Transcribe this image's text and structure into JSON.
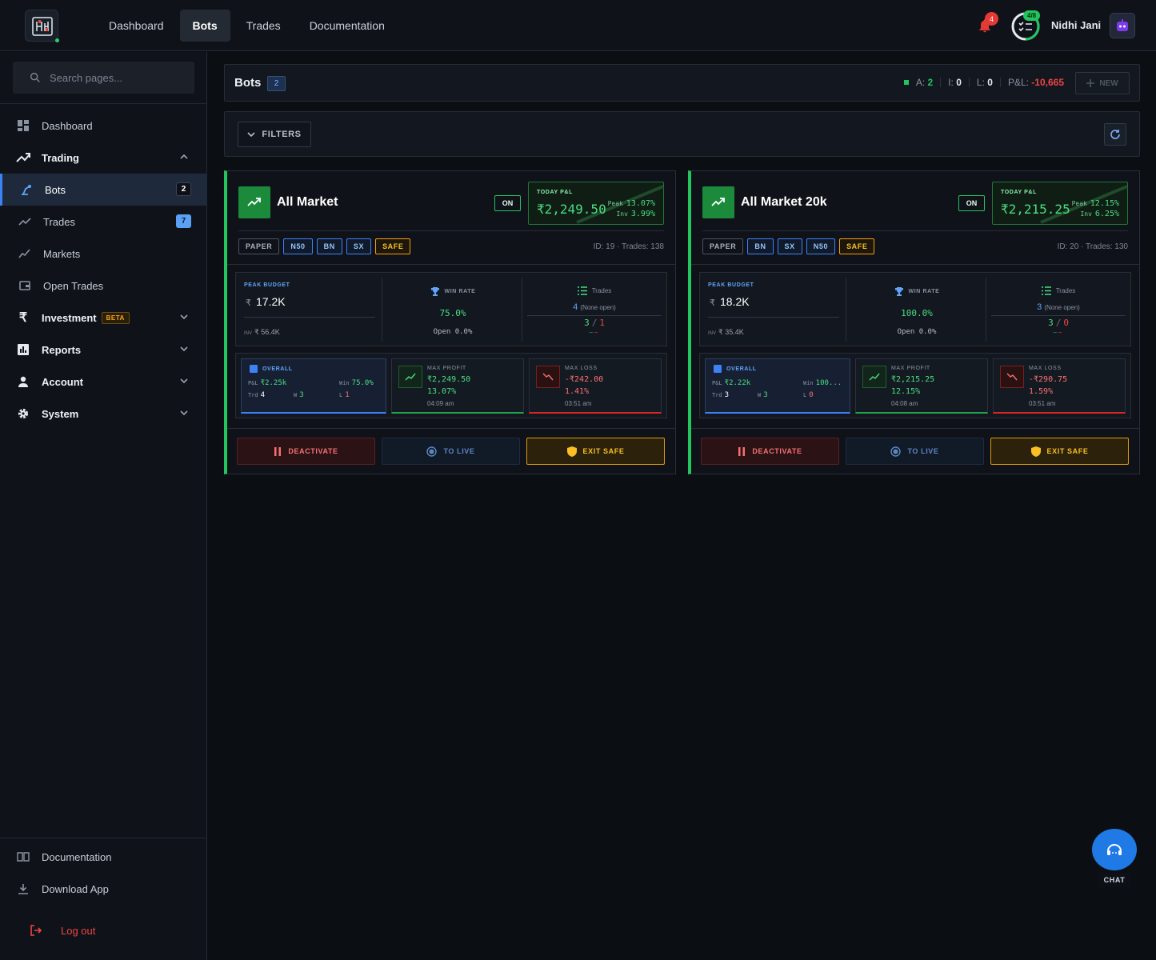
{
  "topbar": {
    "nav": [
      "Dashboard",
      "Bots",
      "Trades",
      "Documentation"
    ],
    "active_nav": "Bots",
    "notifications_count": "4",
    "progress": {
      "label": "4/8",
      "fraction": 0.5
    },
    "user_name": "Nidhi Jani"
  },
  "sidebar": {
    "search_placeholder": "Search pages...",
    "dashboard": "Dashboard",
    "trading": "Trading",
    "bots": "Bots",
    "bots_count": "2",
    "trades": "Trades",
    "trades_count": "7",
    "markets": "Markets",
    "open_trades": "Open Trades",
    "investment": "Investment",
    "beta": "BETA",
    "reports": "Reports",
    "account": "Account",
    "system": "System",
    "documentation": "Documentation",
    "download_app": "Download App",
    "logout": "Log out"
  },
  "header": {
    "title": "Bots",
    "count": "2",
    "a_label": "A:",
    "a_value": "2",
    "i_label": "I:",
    "i_value": "0",
    "l_label": "L:",
    "l_value": "0",
    "pnl_label": "P&L:",
    "pnl_value": "-10,665",
    "new_label": "NEW",
    "filters_label": "FILTERS"
  },
  "colors": {
    "accent": "#3b82f6",
    "profit": "#22c55e",
    "loss": "#ef4444",
    "safe": "#f59e0b"
  },
  "bots": [
    {
      "name": "All Market",
      "status": "ON",
      "today_label": "TODAY P&L",
      "today_value": "₹2,249.50",
      "peak_label": "Peak",
      "peak_value": "13.07%",
      "inv_label": "Inv",
      "inv_value": "3.99%",
      "tags": [
        "PAPER",
        "N50",
        "BN",
        "SX",
        "SAFE"
      ],
      "id_text": "ID: 19",
      "trades_text": "Trades: 138",
      "peak_budget_label": "PEAK BUDGET",
      "peak_budget": "17.2K",
      "inv_small_label": "INV",
      "inv_amount": "₹ 56.4K",
      "win_rate_label": "WIN RATE",
      "win_rate": "75.0%",
      "open_rate": "Open 0.0%",
      "trades_label": "Trades",
      "trades_count": "4",
      "none_open": "(None open)",
      "wins": "3",
      "losses": "1",
      "overall_label": "OVERALL",
      "ov_pnl": "₹2.25k",
      "ov_win": "75.0%",
      "ov_trd": "4",
      "ov_w": "3",
      "ov_l": "1",
      "max_profit_label": "MAX PROFIT",
      "max_profit": "₹2,249.50",
      "max_profit_pct": "13.07%",
      "max_profit_time": "04:09 am",
      "max_loss_label": "MAX LOSS",
      "max_loss": "-₹242.00",
      "max_loss_pct": "1.41%",
      "max_loss_time": "03:51 am",
      "deactivate": "DEACTIVATE",
      "to_live": "TO LIVE",
      "exit_safe": "EXIT SAFE"
    },
    {
      "name": "All Market 20k",
      "status": "ON",
      "today_label": "TODAY P&L",
      "today_value": "₹2,215.25",
      "peak_label": "Peak",
      "peak_value": "12.15%",
      "inv_label": "Inv",
      "inv_value": "6.25%",
      "tags": [
        "PAPER",
        "BN",
        "SX",
        "N50",
        "SAFE"
      ],
      "id_text": "ID: 20",
      "trades_text": "Trades: 130",
      "peak_budget_label": "PEAK BUDGET",
      "peak_budget": "18.2K",
      "inv_small_label": "INV",
      "inv_amount": "₹ 35.4K",
      "win_rate_label": "WIN RATE",
      "win_rate": "100.0%",
      "open_rate": "Open 0.0%",
      "trades_label": "Trades",
      "trades_count": "3",
      "none_open": "(None open)",
      "wins": "3",
      "losses": "0",
      "overall_label": "OVERALL",
      "ov_pnl": "₹2.22k",
      "ov_win": "100...",
      "ov_trd": "3",
      "ov_w": "3",
      "ov_l": "0",
      "max_profit_label": "MAX PROFIT",
      "max_profit": "₹2,215.25",
      "max_profit_pct": "12.15%",
      "max_profit_time": "04:08 am",
      "max_loss_label": "MAX LOSS",
      "max_loss": "-₹290.75",
      "max_loss_pct": "1.59%",
      "max_loss_time": "03:51 am",
      "deactivate": "DEACTIVATE",
      "to_live": "TO LIVE",
      "exit_safe": "EXIT SAFE"
    }
  ],
  "chat_label": "CHAT"
}
